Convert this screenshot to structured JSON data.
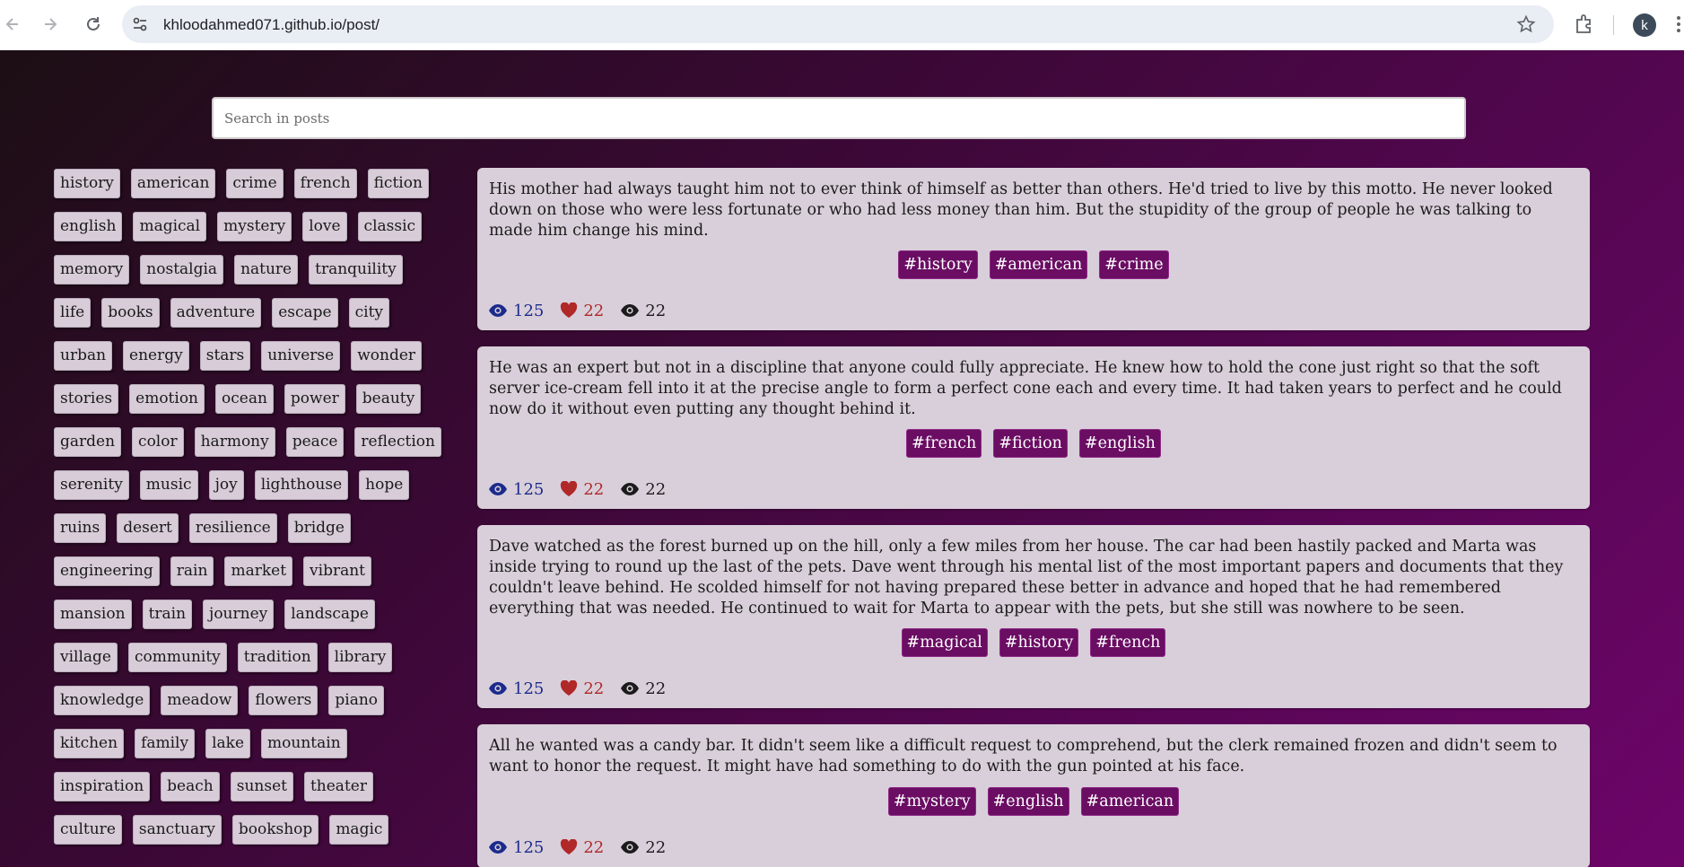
{
  "browser": {
    "url": "khloodahmed071.github.io/post/",
    "avatar_letter": "k"
  },
  "search": {
    "placeholder": "Search in posts"
  },
  "tags": [
    [
      "history",
      "american",
      "crime",
      "french",
      "fiction"
    ],
    [
      "english",
      "magical",
      "mystery",
      "love",
      "classic"
    ],
    [
      "memory",
      "nostalgia",
      "nature",
      "tranquility"
    ],
    [
      "life",
      "books",
      "adventure",
      "escape",
      "city"
    ],
    [
      "urban",
      "energy",
      "stars",
      "universe",
      "wonder"
    ],
    [
      "stories",
      "emotion",
      "ocean",
      "power",
      "beauty"
    ],
    [
      "garden",
      "color",
      "harmony",
      "peace",
      "reflection"
    ],
    [
      "serenity",
      "music",
      "joy",
      "lighthouse",
      "hope"
    ],
    [
      "ruins",
      "desert",
      "resilience",
      "bridge"
    ],
    [
      "engineering",
      "rain",
      "market",
      "vibrant"
    ],
    [
      "mansion",
      "train",
      "journey",
      "landscape"
    ],
    [
      "village",
      "community",
      "tradition",
      "library"
    ],
    [
      "knowledge",
      "meadow",
      "flowers",
      "piano"
    ],
    [
      "kitchen",
      "family",
      "lake",
      "mountain"
    ],
    [
      "inspiration",
      "beach",
      "sunset",
      "theater"
    ],
    [
      "culture",
      "sanctuary",
      "bookshop",
      "magic"
    ]
  ],
  "posts": [
    {
      "text": "His mother had always taught him not to ever think of himself as better than others. He'd tried to live by this motto. He never looked down on those who were less fortunate or who had less money than him. But the stupidity of the group of people he was talking to made him change his mind.",
      "tags": [
        "#history",
        "#american",
        "#crime"
      ],
      "views": "125",
      "likes": "22",
      "seen": "22"
    },
    {
      "text": "He was an expert but not in a discipline that anyone could fully appreciate. He knew how to hold the cone just right so that the soft server ice-cream fell into it at the precise angle to form a perfect cone each and every time. It had taken years to perfect and he could now do it without even putting any thought behind it.",
      "tags": [
        "#french",
        "#fiction",
        "#english"
      ],
      "views": "125",
      "likes": "22",
      "seen": "22"
    },
    {
      "text": "Dave watched as the forest burned up on the hill, only a few miles from her house. The car had been hastily packed and Marta was inside trying to round up the last of the pets. Dave went through his mental list of the most important papers and documents that they couldn't leave behind. He scolded himself for not having prepared these better in advance and hoped that he had remembered everything that was needed. He continued to wait for Marta to appear with the pets, but she still was nowhere to be seen.",
      "tags": [
        "#magical",
        "#history",
        "#french"
      ],
      "views": "125",
      "likes": "22",
      "seen": "22"
    },
    {
      "text": "All he wanted was a candy bar. It didn't seem like a difficult request to comprehend, but the clerk remained frozen and didn't seem to want to honor the request. It might have had something to do with the gun pointed at his face.",
      "tags": [
        "#mystery",
        "#english",
        "#american"
      ],
      "views": "125",
      "likes": "22",
      "seen": "22"
    }
  ]
}
